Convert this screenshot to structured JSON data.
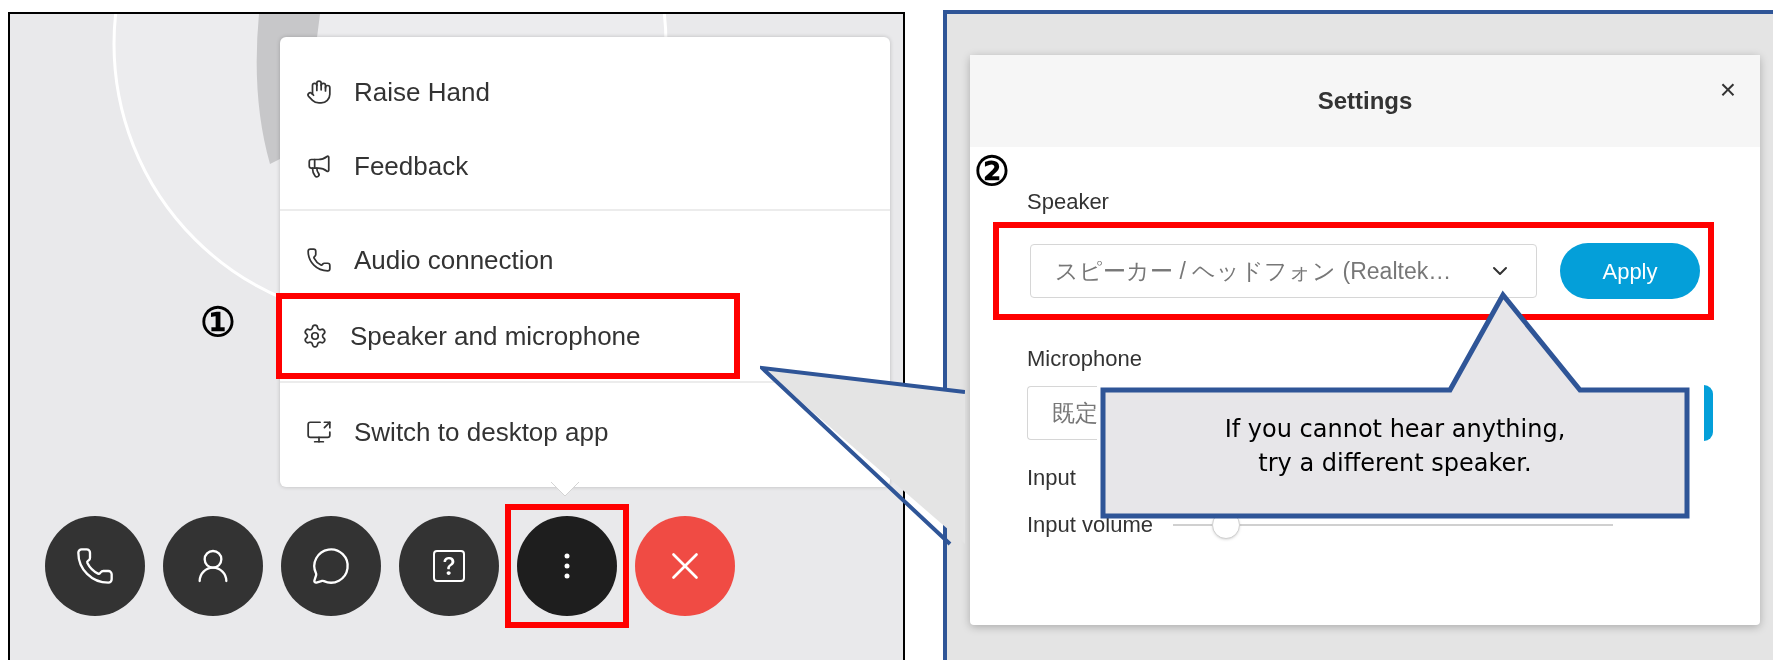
{
  "meeting": {
    "menu": {
      "groups": [
        [
          {
            "kind": "hand",
            "label": "Raise Hand",
            "highlighted": false
          },
          {
            "kind": "megaphone",
            "label": "Feedback",
            "highlighted": false
          }
        ],
        [
          {
            "kind": "phone",
            "label": "Audio connection",
            "highlighted": false
          },
          {
            "kind": "gear",
            "label": "Speaker and microphone",
            "highlighted": true,
            "marker": "①"
          }
        ],
        [
          {
            "kind": "monitor",
            "label": "Switch to desktop app",
            "highlighted": false
          }
        ]
      ]
    },
    "toolbar": [
      {
        "kind": "phone",
        "highlighted": false
      },
      {
        "kind": "participants",
        "highlighted": false
      },
      {
        "kind": "chat",
        "highlighted": false
      },
      {
        "kind": "help",
        "highlighted": false
      },
      {
        "kind": "more",
        "highlighted": true
      },
      {
        "kind": "end",
        "highlighted": false
      }
    ]
  },
  "settings": {
    "title": "Settings",
    "close": "×",
    "marker": "②",
    "speaker": {
      "label": "Speaker",
      "value": "スピーカー / ヘッドフォン (Realtek…",
      "button": "Apply",
      "highlighted": true
    },
    "microphone": {
      "label": "Microphone",
      "value": "既定"
    },
    "input_level": {
      "label": "Input"
    },
    "input_volume": {
      "label": "Input volume",
      "level": 0.12
    }
  },
  "callout": {
    "text": "If you cannot hear anything,\ntry a different speaker."
  }
}
